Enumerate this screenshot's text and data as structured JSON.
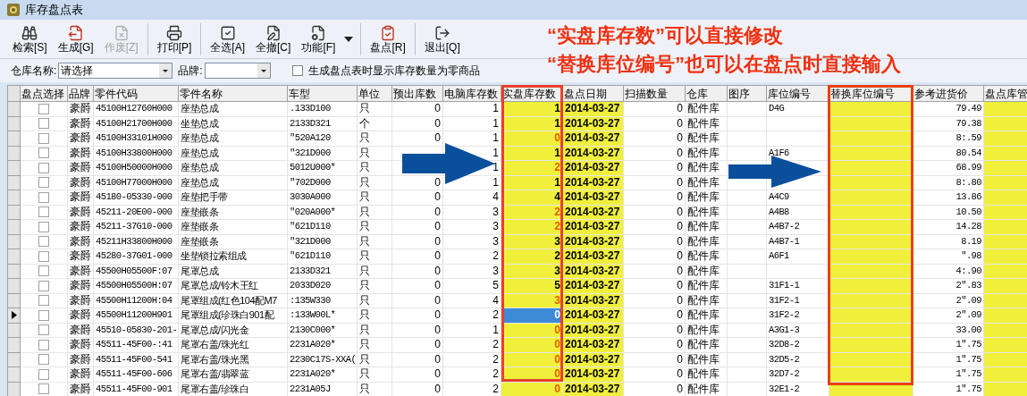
{
  "window": {
    "title": "库存盘点表"
  },
  "toolbar": [
    {
      "label": "检索[S]",
      "disabled": false
    },
    {
      "label": "生成[G]",
      "disabled": false
    },
    {
      "label": "作废[Z]",
      "disabled": true
    },
    {
      "label": "打印[P]",
      "disabled": false
    },
    {
      "label": "全选[A]",
      "disabled": false
    },
    {
      "label": "全撤[C]",
      "disabled": false
    },
    {
      "label": "功能[F]",
      "disabled": false
    },
    {
      "label": "盘点[R]",
      "disabled": false
    },
    {
      "label": "退出[Q]",
      "disabled": false
    }
  ],
  "filters": {
    "warehouse_label": "仓库名称:",
    "warehouse_value": "请选择",
    "brand_label": "品牌:",
    "zero_stock": {
      "label": "生成盘点表时显示库存数量为零商品",
      "checked": false
    }
  },
  "table": {
    "columns": [
      {
        "label": "盘点选择",
        "highlighted": false
      },
      {
        "label": "品牌",
        "highlighted": false
      },
      {
        "label": "零件代码",
        "highlighted": false
      },
      {
        "label": "零件名称",
        "highlighted": false
      },
      {
        "label": "车型",
        "highlighted": false
      },
      {
        "label": "单位",
        "highlighted": false
      },
      {
        "label": "预出库数",
        "highlighted": false
      },
      {
        "label": "电脑库存数",
        "highlighted": false
      },
      {
        "label": "实盘库存数",
        "highlighted": true
      },
      {
        "label": "盘点日期",
        "highlighted": true
      },
      {
        "label": "扫描数量",
        "highlighted": false
      },
      {
        "label": "仓库",
        "highlighted": false
      },
      {
        "label": "图序",
        "highlighted": false
      },
      {
        "label": "库位编号",
        "highlighted": false
      },
      {
        "label": "替换库位编号",
        "highlighted": true
      },
      {
        "label": "参考进货价",
        "highlighted": false
      },
      {
        "label": "盘点库管",
        "highlighted": true
      }
    ],
    "rows": [
      {
        "selected": false,
        "checked": false,
        "brand": "豪爵",
        "part_code": "45100H12760H000",
        "part_name": "座垫总成",
        "model": ".133D100",
        "unit": "只",
        "pre_out": "0",
        "computer_stock": "1",
        "actual_stock": "1",
        "actual_flagged": false,
        "date": "2014-03-27",
        "scan_qty": "0",
        "warehouse": "配件库",
        "location": "D4G",
        "price": "79.49"
      },
      {
        "selected": false,
        "checked": false,
        "brand": "豪爵",
        "part_code": "45100H21700H000",
        "part_name": "坐垫总成",
        "model": "2133D321",
        "unit": "个",
        "pre_out": "0",
        "computer_stock": "1",
        "actual_stock": "1",
        "actual_flagged": false,
        "date": "2014-03-27",
        "scan_qty": "0",
        "warehouse": "配件库",
        "price": "79.38"
      },
      {
        "selected": false,
        "checked": false,
        "brand": "豪爵",
        "part_code": "45100H33101H000",
        "part_name": "座垫总成",
        "model": "\"520A120",
        "unit": "只",
        "pre_out": "0",
        "computer_stock": "1",
        "actual_stock": "0",
        "actual_flagged": true,
        "date": "2014-03-27",
        "scan_qty": "0",
        "warehouse": "配件库",
        "price": "8:.59"
      },
      {
        "selected": false,
        "checked": false,
        "brand": "豪爵",
        "part_code": "45100H33800H000",
        "part_name": "座垫总成",
        "model": "\"321D000",
        "unit": "只",
        "computer_stock": "1",
        "actual_stock": "1",
        "actual_flagged": false,
        "date": "2014-03-27",
        "scan_qty": "0",
        "warehouse": "配件库",
        "location": "A1F6",
        "price": "80.54"
      },
      {
        "selected": false,
        "checked": false,
        "brand": "豪爵",
        "part_code": "45100H50000H000",
        "part_name": "座垫总成",
        "model": "5012U000*",
        "unit": "只",
        "computer_stock": "1",
        "actual_stock": "2",
        "actual_flagged": true,
        "date": "2014-03-27",
        "scan_qty": "0",
        "warehouse": "配件库",
        "price": "68.99"
      },
      {
        "selected": false,
        "checked": false,
        "brand": "豪爵",
        "part_code": "45100H77000H000",
        "part_name": "座垫总成",
        "model": "\"702D000",
        "unit": "只",
        "pre_out": "0",
        "computer_stock": "1",
        "actual_stock": "1",
        "actual_flagged": false,
        "date": "2014-03-27",
        "scan_qty": "0",
        "warehouse": "配件库",
        "price": "8:.80"
      },
      {
        "selected": false,
        "checked": false,
        "brand": "豪爵",
        "part_code": "45180-05330-000",
        "part_name": "座垫把手带",
        "model": "3030A000",
        "unit": "只",
        "pre_out": "0",
        "computer_stock": "4",
        "actual_stock": "4",
        "actual_flagged": false,
        "date": "2014-03-27",
        "scan_qty": "0",
        "warehouse": "配件库",
        "location": "A4C9",
        "price": "13.86"
      },
      {
        "selected": false,
        "checked": false,
        "brand": "豪爵",
        "part_code": "45211-20E00-000",
        "part_name": "座垫嵌条",
        "model": "\"020A000*",
        "unit": "只",
        "pre_out": "0",
        "computer_stock": "3",
        "actual_stock": "2",
        "actual_flagged": true,
        "date": "2014-03-27",
        "scan_qty": "0",
        "warehouse": "配件库",
        "location": "A4B8",
        "price": "10.50"
      },
      {
        "selected": false,
        "checked": false,
        "brand": "豪爵",
        "part_code": "45211-37G10-000",
        "part_name": "座垫嵌条",
        "model": "\"621D110",
        "unit": "只",
        "pre_out": "0",
        "computer_stock": "3",
        "actual_stock": "2",
        "actual_flagged": true,
        "date": "2014-03-27",
        "scan_qty": "0",
        "warehouse": "配件库",
        "location": "A4B7-2",
        "price": "14.28"
      },
      {
        "selected": false,
        "checked": false,
        "brand": "豪爵",
        "part_code": "45211H33800H000",
        "part_name": "座垫嵌条",
        "model": "\"321D000",
        "unit": "只",
        "pre_out": "0",
        "computer_stock": "3",
        "actual_stock": "3",
        "actual_flagged": false,
        "date": "2014-03-27",
        "scan_qty": "0",
        "warehouse": "配件库",
        "location": "A4B7-1",
        "price": "8.19"
      },
      {
        "selected": false,
        "checked": false,
        "brand": "豪爵",
        "part_code": "45280-37G01-000",
        "part_name": "坐垫锁拉索组成",
        "model": "\"621D110",
        "unit": "只",
        "pre_out": "0",
        "computer_stock": "2",
        "actual_stock": "2",
        "actual_flagged": false,
        "date": "2014-03-27",
        "scan_qty": "0",
        "warehouse": "配件库",
        "location": "A6F1",
        "price": "\".98"
      },
      {
        "selected": false,
        "checked": false,
        "brand": "豪爵",
        "part_code": "45500H05500F:07",
        "part_name": "尾罩总成",
        "model": "2133D321",
        "unit": "只",
        "pre_out": "0",
        "computer_stock": "3",
        "actual_stock": "3",
        "actual_flagged": false,
        "date": "2014-03-27",
        "scan_qty": "0",
        "warehouse": "配件库",
        "price": "4:.90"
      },
      {
        "selected": false,
        "checked": false,
        "brand": "豪爵",
        "part_code": "45500H05500H:07",
        "part_name": "尾罩总成/铃木王红",
        "model": "2033D020",
        "unit": "只",
        "pre_out": "0",
        "computer_stock": "5",
        "actual_stock": "5",
        "actual_flagged": false,
        "date": "2014-03-27",
        "scan_qty": "0",
        "warehouse": "配件库",
        "location": "31F1-1",
        "price": "2\".83"
      },
      {
        "selected": false,
        "checked": false,
        "brand": "豪爵",
        "part_code": "45500H11200H:04",
        "part_name": "尾罩组成(红色104配M7",
        "model": ":135W330",
        "unit": "只",
        "pre_out": "0",
        "computer_stock": "4",
        "actual_stock": "3",
        "actual_flagged": true,
        "date": "2014-03-27",
        "scan_qty": "0",
        "warehouse": "配件库",
        "location": "31F2-1",
        "price": "2\".09"
      },
      {
        "selected": true,
        "checked": false,
        "brand": "豪爵",
        "part_code": "45500H11200H901",
        "part_name": "尾罩组成(珍珠白901配",
        "model": ":133W00L*",
        "unit": "只",
        "pre_out": "0",
        "computer_stock": "2",
        "actual_stock": "0",
        "date": "2014-03-27",
        "scan_qty": "0",
        "warehouse": "配件库",
        "location": "31F2-2",
        "price": "2\".09"
      },
      {
        "selected": false,
        "checked": false,
        "brand": "豪爵",
        "part_code": "45510-05830-201-",
        "part_name": "尾罩总成/闪光金",
        "model": "2130C000*",
        "unit": "只",
        "pre_out": "0",
        "computer_stock": "1",
        "actual_stock": "0",
        "actual_flagged": true,
        "date": "2014-03-27",
        "scan_qty": "0",
        "warehouse": "配件库",
        "location": "A3G1-3",
        "price": "33.00"
      },
      {
        "selected": false,
        "checked": false,
        "brand": "豪爵",
        "part_code": "45511-45F00-:41",
        "part_name": "尾罩右盖/珠光红",
        "model": "2231A020*",
        "unit": "只",
        "pre_out": "0",
        "computer_stock": "2",
        "actual_stock": "0",
        "actual_flagged": true,
        "date": "2014-03-27",
        "scan_qty": "0",
        "warehouse": "配件库",
        "location": "32D8-2",
        "price": "1\".75"
      },
      {
        "selected": false,
        "checked": false,
        "brand": "豪爵",
        "part_code": "45511-45F00-541",
        "part_name": "尾罩右盖/珠光黑",
        "model": "2230C17S-XXA(",
        "unit": "只",
        "pre_out": "0",
        "computer_stock": "2",
        "actual_stock": "0",
        "actual_flagged": true,
        "date": "2014-03-27",
        "scan_qty": "0",
        "warehouse": "配件库",
        "location": "32D5-2",
        "price": "1\".75"
      },
      {
        "selected": false,
        "checked": false,
        "brand": "豪爵",
        "part_code": "45511-45F00-606",
        "part_name": "尾罩右盖/翡翠蓝",
        "model": "2231A020*",
        "unit": "只",
        "pre_out": "0",
        "computer_stock": "2",
        "actual_stock": "0",
        "actual_flagged": true,
        "date": "2014-03-27",
        "scan_qty": "0",
        "warehouse": "配件库",
        "location": "32D7-2",
        "price": "1\".75"
      },
      {
        "selected": false,
        "checked": false,
        "brand": "豪爵",
        "part_code": "45511-45F00-901",
        "part_name": "尾罩右盖/珍珠白",
        "model": "2231A05J",
        "unit": "只",
        "pre_out": "0",
        "computer_stock": "2",
        "actual_stock": "0",
        "actual_flagged": true,
        "date": "2014-03-27",
        "scan_qty": "0",
        "warehouse": "配件库",
        "location": "32E1-2",
        "price": "1\".75"
      }
    ]
  },
  "annotations": {
    "notes": [
      "“实盘库存数”可以直接修改",
      "“替换库位编号”也可以在盘点时直接输入"
    ]
  }
}
